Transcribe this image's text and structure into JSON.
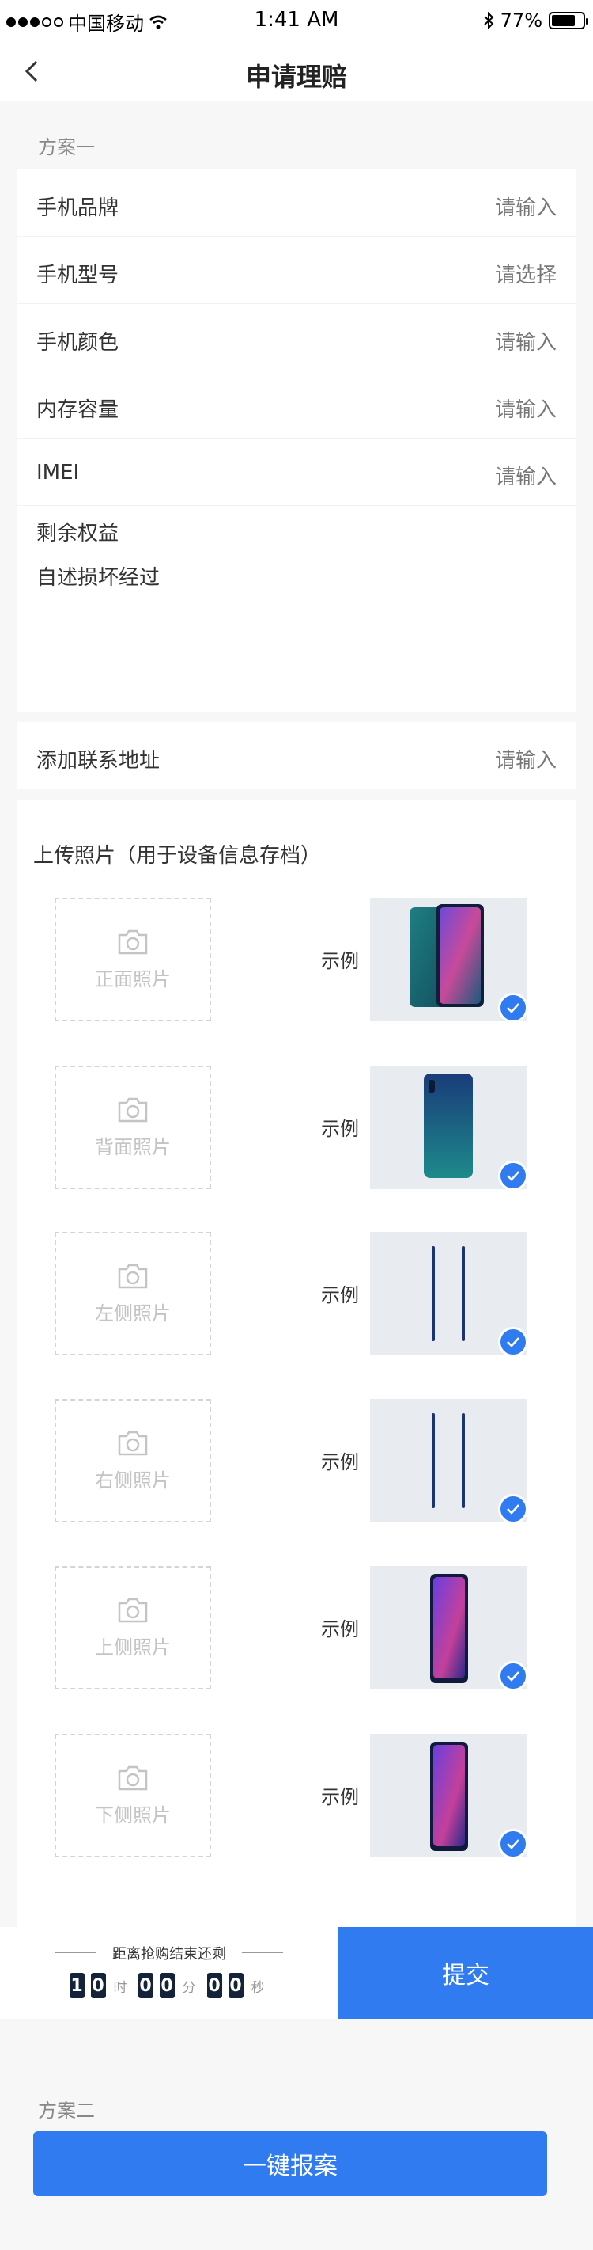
{
  "status_bar": {
    "carrier": "中国移动",
    "time": "1:41 AM",
    "battery": "77%",
    "battery_level": 0.77
  },
  "nav": {
    "title": "申请理赔"
  },
  "plan1": {
    "label": "方案一",
    "fields": [
      {
        "label": "手机品牌",
        "value": "请输入"
      },
      {
        "label": "手机型号",
        "value": "请选择"
      },
      {
        "label": "手机颜色",
        "value": "请输入"
      },
      {
        "label": "内存容量",
        "value": "请输入"
      },
      {
        "label": "IMEI",
        "value": "请输入"
      }
    ],
    "remaining_rights": "剩余权益",
    "damage_description": "自述损坏经过",
    "address": {
      "label": "添加联系地址",
      "value": "请输入"
    }
  },
  "upload": {
    "title": "上传照片（用于设备信息存档）",
    "example_label": "示例",
    "slots": [
      {
        "label": "正面照片"
      },
      {
        "label": "背面照片"
      },
      {
        "label": "左侧照片"
      },
      {
        "label": "右侧照片"
      },
      {
        "label": "上侧照片"
      },
      {
        "label": "下侧照片"
      }
    ]
  },
  "countdown": {
    "title": "距离抢购结束还剩",
    "hours": [
      "1",
      "0"
    ],
    "minutes": [
      "0",
      "0"
    ],
    "seconds": [
      "0",
      "0"
    ],
    "unit_hours": "时",
    "unit_minutes": "分",
    "unit_seconds": "秒"
  },
  "submit_label": "提交",
  "plan2": {
    "label": "方案二",
    "button": "一键报案"
  },
  "colors": {
    "accent": "#2f7bef",
    "digit_bg": "#15233a",
    "page_bg": "#f7f7f7"
  }
}
